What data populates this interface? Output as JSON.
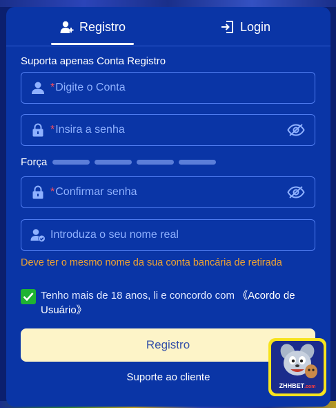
{
  "tabs": [
    {
      "label": "Registro",
      "icon": "user-add-icon",
      "active": true
    },
    {
      "label": "Login",
      "icon": "login-icon",
      "active": false
    }
  ],
  "form": {
    "section_label": "Suporta apenas Conta Registro",
    "account_placeholder": "Digite o Conta",
    "password_placeholder": "Insira a senha",
    "strength_label": "Força",
    "strength_level": 0,
    "confirm_placeholder": "Confirmar senha",
    "realname_placeholder": "Introduza o seu nome real",
    "realname_warning": "Deve ter o mesmo nome da sua conta bancária de retirada",
    "required_mark": "*",
    "terms_text": "Tenho mais de 18 anos, li e concordo com ",
    "terms_link": "《Acordo de Usuário》",
    "terms_checked": true,
    "submit_label": "Registro",
    "support_label": "Suporte ao cliente"
  },
  "badge": {
    "brand": "ZHHBET",
    "suffix": ".com"
  },
  "colors": {
    "panel": "#0a35a6",
    "accent_border": "#4f7cf0",
    "placeholder": "#8fb1ff",
    "required": "#ff4d5a",
    "warning": "#f0a431",
    "checkbox": "#1fb332",
    "submit_bg": "#fdf4c8"
  }
}
